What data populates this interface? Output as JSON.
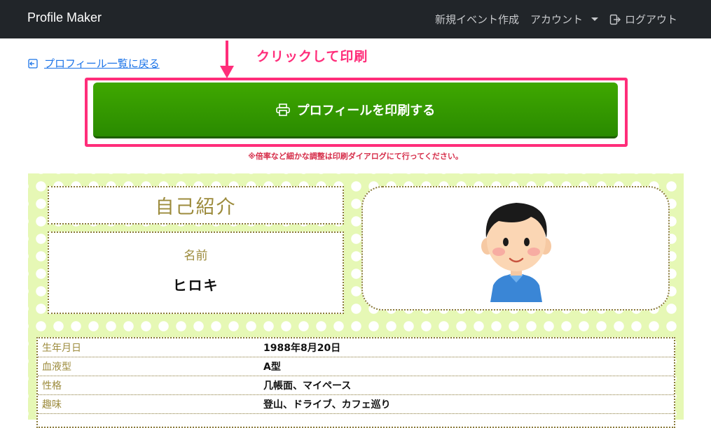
{
  "navbar": {
    "brand": "Profile Maker",
    "new_event": "新規イベント作成",
    "account": "アカウント",
    "logout": "ログアウト"
  },
  "back_link": "プロフィール一覧に戻る",
  "annotation": "クリックして印刷",
  "print_button": "プロフィールを印刷する",
  "print_note": "※倍率など細かな調整は印刷ダイアログにて行ってください。",
  "profile": {
    "title": "自己紹介",
    "name_label": "名前",
    "name_value": "ヒロキ",
    "rows": [
      {
        "label": "生年月日",
        "value": "1988年8月20日"
      },
      {
        "label": "血液型",
        "value": "A型"
      },
      {
        "label": "性格",
        "value": "几帳面、マイペース"
      },
      {
        "label": "趣味",
        "value": "登山、ドライブ、カフェ巡り"
      }
    ]
  },
  "colors": {
    "accent_pink": "#ff2d7a",
    "button_green": "#3fa800",
    "card_bg": "#e6f8b5",
    "label_olive": "#9c8b3c"
  }
}
